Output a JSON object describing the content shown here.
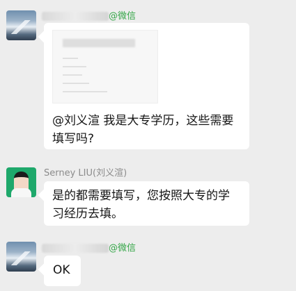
{
  "messages": [
    {
      "sender_suffix": "@微信",
      "text": "@刘义渲 我是大专学历，这些需要填写吗?"
    },
    {
      "sender": "Serney LIU(刘义渲)",
      "text": "是的都需要填写，您按照大专的学习经历去填。"
    },
    {
      "sender_suffix": "@微信",
      "text": "OK"
    }
  ]
}
